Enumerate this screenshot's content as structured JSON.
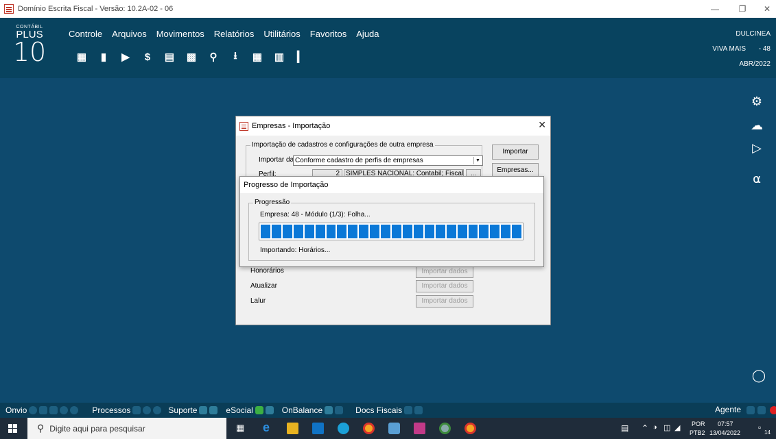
{
  "window": {
    "title": "Domínio Escrita Fiscal - Versão: 10.2A-02 - 06"
  },
  "logo": {
    "line1": "CONTÁBIL",
    "line2": "PLUS",
    "line3": "10"
  },
  "menu": [
    "Controle",
    "Arquivos",
    "Movimentos",
    "Relatórios",
    "Utilitários",
    "Favoritos",
    "Ajuda"
  ],
  "toolbar_icons": [
    "building-icon",
    "import-icon",
    "export-icon",
    "money-doc-icon",
    "printer-icon",
    "calculator-doc-icon",
    "search-icon",
    "download-icon",
    "calculator-icon",
    "chart-search-icon",
    "door-icon"
  ],
  "header_right": {
    "user": "DULCINEA",
    "company": "VIVA MAIS",
    "company_code": "- 48",
    "period": "ABR/2022"
  },
  "empresas_dialog": {
    "title": "Empresas - Importação",
    "group_title": "Importação de cadastros e configurações de outra empresa",
    "import_label": "Importar dados:",
    "import_value": "Conforme cadastro de perfis de empresas",
    "perfil_label": "Perfil:",
    "perfil_number": "2",
    "perfil_name": "SIMPLES NACIONAL: Contabil; Fiscal e",
    "ellipsis": "...",
    "btn_importar": "Importar",
    "btn_empresas": "Empresas...",
    "rows": [
      {
        "label": "Honorários",
        "button": "Importar dados"
      },
      {
        "label": "Atualizar",
        "button": "Importar dados"
      },
      {
        "label": "Lalur",
        "button": "Importar dados"
      }
    ]
  },
  "progress_dialog": {
    "title": "Progresso de Importação",
    "group_title": "Progressão",
    "status": "Empresa: 48 - Módulo (1/3): Folha...",
    "detail": "Importando: Horários...",
    "progress": 1.0
  },
  "bottom_strip": {
    "items": [
      "Onvio",
      "Processos",
      "Suporte",
      "eSocial",
      "OnBalance",
      "Docs Fiscais"
    ],
    "agent": "Agente"
  },
  "taskbar": {
    "search_placeholder": "Digite aqui para pesquisar",
    "lang1": "POR",
    "lang2": "PTB2",
    "time": "07:57",
    "date": "13/04/2022",
    "notifications": "14"
  },
  "colors": {
    "header": "#08435f",
    "desktop": "#0e4a6e",
    "progress": "#0a78d7",
    "accent_red": "#c0392b"
  }
}
